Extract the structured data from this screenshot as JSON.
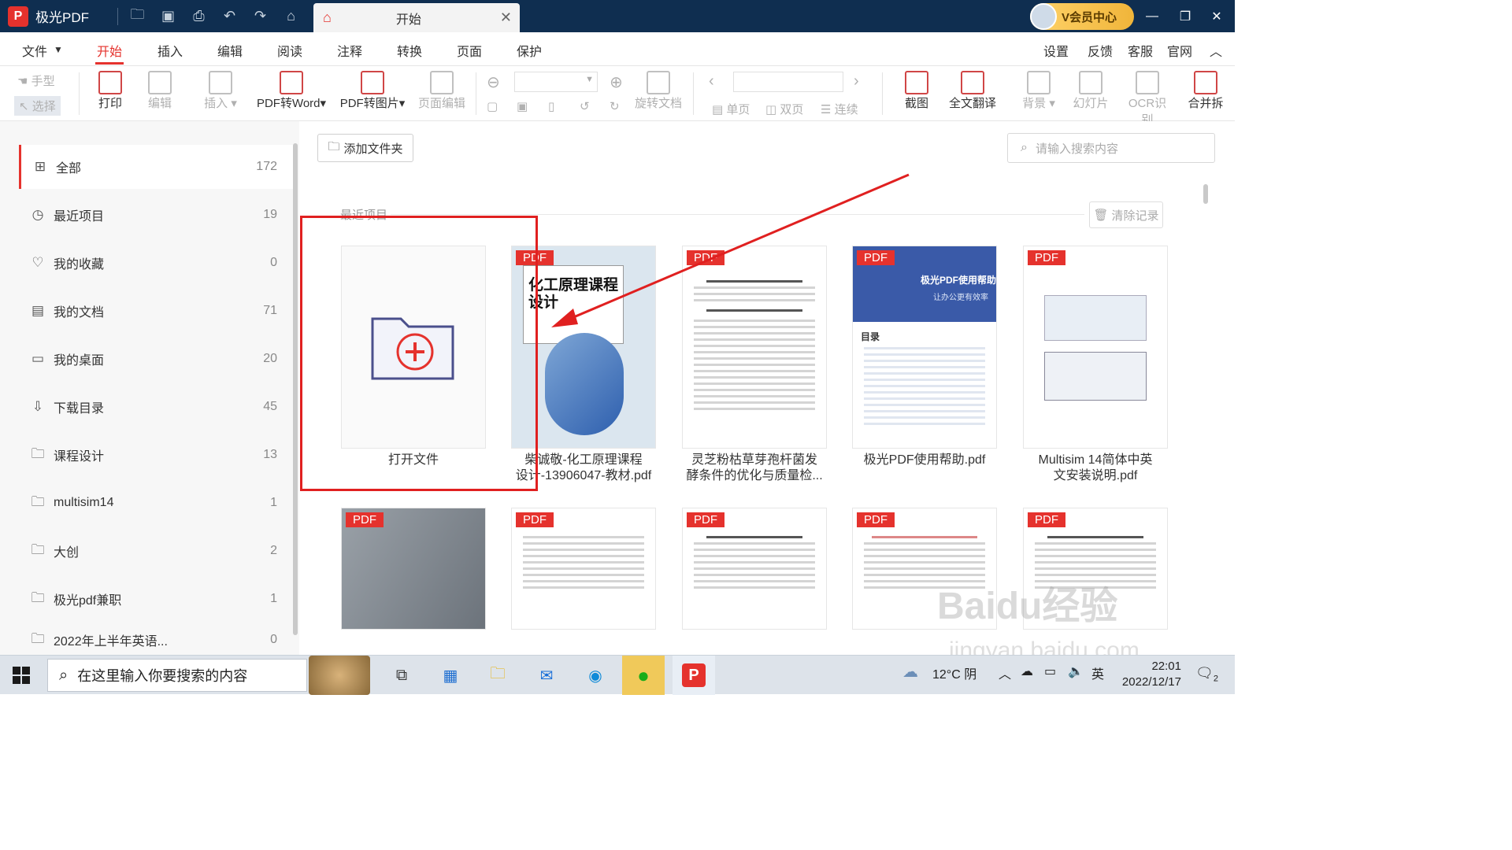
{
  "titlebar": {
    "app_name": "极光PDF",
    "tab_label": "开始",
    "vip_label": "V会员中心",
    "logo_letter": "P"
  },
  "menubar": {
    "file": "文件",
    "items": [
      "开始",
      "插入",
      "编辑",
      "阅读",
      "注释",
      "转换",
      "页面",
      "保护"
    ],
    "right": [
      "设置",
      "反馈",
      "客服",
      "官网"
    ]
  },
  "toolbar": {
    "hand": "手型",
    "select": "选择",
    "print": "打印",
    "edit": "编辑",
    "insert": "插入",
    "pdf_to_word": "PDF转Word",
    "pdf_to_image": "PDF转图片",
    "page_edit": "页面编辑",
    "rotate_doc": "旋转文档",
    "single": "单页",
    "double": "双页",
    "continuous": "连续",
    "screenshot": "截图",
    "translate": "全文翻译",
    "background": "背景",
    "slideshow": "幻灯片",
    "ocr": "OCR识别",
    "merge": "合并拆"
  },
  "sidebar": {
    "items": [
      {
        "label": "全部",
        "count": "172",
        "icon": "grid-icon"
      },
      {
        "label": "最近项目",
        "count": "19",
        "icon": "clock-icon"
      },
      {
        "label": "我的收藏",
        "count": "0",
        "icon": "heart-icon"
      },
      {
        "label": "我的文档",
        "count": "71",
        "icon": "document-icon"
      },
      {
        "label": "我的桌面",
        "count": "20",
        "icon": "monitor-icon"
      },
      {
        "label": "下载目录",
        "count": "45",
        "icon": "download-icon"
      },
      {
        "label": "课程设计",
        "count": "13",
        "icon": "folder-icon"
      },
      {
        "label": "multisim14",
        "count": "1",
        "icon": "folder-icon"
      },
      {
        "label": "大创",
        "count": "2",
        "icon": "folder-icon"
      },
      {
        "label": "极光pdf兼职",
        "count": "1",
        "icon": "folder-icon"
      },
      {
        "label": "2022年上半年英语...",
        "count": "0",
        "icon": "folder-icon"
      }
    ]
  },
  "main": {
    "add_folder": "添加文件夹",
    "search_placeholder": "请输入搜索内容",
    "recent_label": "最近项目",
    "clear_label": "清除记录",
    "open_file": "打开文件",
    "pdf_tag": "PDF",
    "files": [
      {
        "line1": "柴诚敬-化工原理课程",
        "line2": "设计-13906047-教材.pdf",
        "cover_title": "化工原理课程设计"
      },
      {
        "line1": "灵芝粉枯草芽孢杆菌发",
        "line2": "酵条件的优化与质量检..."
      },
      {
        "line1": "极光PDF使用帮助.pdf",
        "line2": "",
        "cover_title": "极光PDF使用帮助",
        "cover_sub": "让办公更有效率",
        "toc": "目录"
      },
      {
        "line1": "Multisim 14简体中英",
        "line2": "文安装说明.pdf"
      }
    ]
  },
  "taskbar": {
    "search_placeholder": "在这里输入你要搜索的内容",
    "weather": "12°C 阴",
    "ime": "英",
    "time": "22:01",
    "date": "2022/12/17",
    "notif_count": "2"
  },
  "watermark": {
    "line1": "Baidu经验",
    "line2": "jingyan.baidu.com"
  },
  "colors": {
    "accent": "#e5322d",
    "titlebar": "#0f2e50",
    "annotation": "#e02020"
  }
}
